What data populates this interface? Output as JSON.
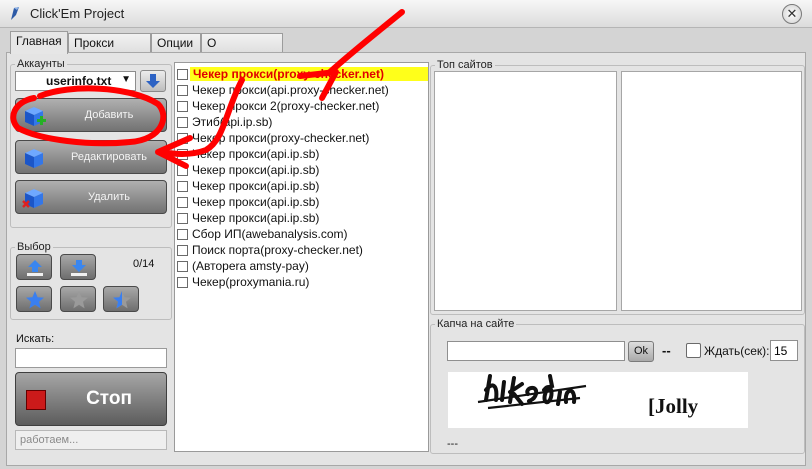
{
  "window": {
    "title": "Click'Em Project",
    "close_glyph": "✕"
  },
  "tabs": [
    {
      "label": "Главная",
      "active": true
    },
    {
      "label": "Прокси чекер"
    },
    {
      "label": "Опции"
    },
    {
      "label": "О программе"
    }
  ],
  "accounts": {
    "group_title": "Аккаунты",
    "selected_file": "userinfo.txt",
    "buttons": {
      "add": "Добавить",
      "edit": "Редактировать",
      "delete": "Удалить"
    }
  },
  "selection": {
    "group_title": "Выбор",
    "count": "0/14"
  },
  "search": {
    "label": "Искать:",
    "value": ""
  },
  "stop_button": {
    "label": "Стоп"
  },
  "status": {
    "text": "работаем..."
  },
  "checker_list": {
    "items": [
      {
        "text": "Чекер прокси(proxy-checker.net)",
        "selected": true
      },
      {
        "text": "Чекер прокси(api.proxy-checker.net)"
      },
      {
        "text": "Чекер прокси 2(proxy-checker.net)"
      },
      {
        "text": "Этиб(api.ip.sb)"
      },
      {
        "text": "Чекер прокси(proxy-checker.net)"
      },
      {
        "text": "Чекер прокси(api.ip.sb)"
      },
      {
        "text": "Чекер прокси(api.ip.sb)"
      },
      {
        "text": "Чекер прокси(api.ip.sb)"
      },
      {
        "text": "Чекер прокси(api.ip.sb)"
      },
      {
        "text": "Чекер прокси(api.ip.sb)"
      },
      {
        "text": "Сбор ИП(awebanalysis.com)"
      },
      {
        "text": "Поиск порта(proxy-checker.net)"
      },
      {
        "text": "(Автореrа amsty-pay)"
      },
      {
        "text": "Чекер(proxymania.ru)"
      }
    ]
  },
  "top_sites": {
    "group_title": "Топ сайтов"
  },
  "captcha": {
    "group_title": "Капча на сайте",
    "input_value": "",
    "ok_label": "Ok",
    "dash": "--",
    "wait_label": "Ждать(сек):",
    "wait_value": "15",
    "image_text": "hiked​n",
    "image_word": "[Jolly",
    "footer": "---"
  },
  "colors": {
    "selected_highlight": "#ffff1a",
    "selected_text": "#e00000",
    "annotation": "#ff0000",
    "stop_square": "#cc1a1a"
  }
}
